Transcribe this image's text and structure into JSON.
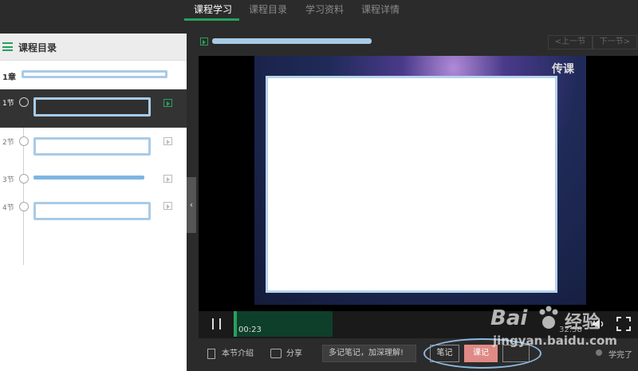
{
  "topnav": {
    "tabs": [
      "课程学习",
      "课程目录",
      "学习资料",
      "课程详情"
    ],
    "active_tab": "课程学习",
    "accent_color": "#27a15c"
  },
  "sidebar": {
    "title": "课程目录",
    "chapter": {
      "label": "1章"
    },
    "lessons": [
      {
        "label": "1节",
        "active": true
      },
      {
        "label": "2节",
        "active": false
      },
      {
        "label": "3节",
        "active": false
      },
      {
        "label": "4节",
        "active": false
      }
    ],
    "collapse_icon": "chevron-left-icon"
  },
  "player": {
    "prev_label": "<上一节",
    "next_label": "下一节>",
    "brand": "传课",
    "current_time": "00:23",
    "total_time": "32:58",
    "progress_fraction": 0.007
  },
  "toolbar": {
    "intro_label": "本节介绍",
    "share_label": "分享",
    "note_placeholder": "多记笔记，加深理解!",
    "note_button": "笔记",
    "notes_list_button": "课记",
    "third_button": "",
    "done_label": "学完了"
  },
  "watermark": {
    "brand": "Bai",
    "brand2": "经验",
    "url": "jingyan.baidu.com"
  }
}
